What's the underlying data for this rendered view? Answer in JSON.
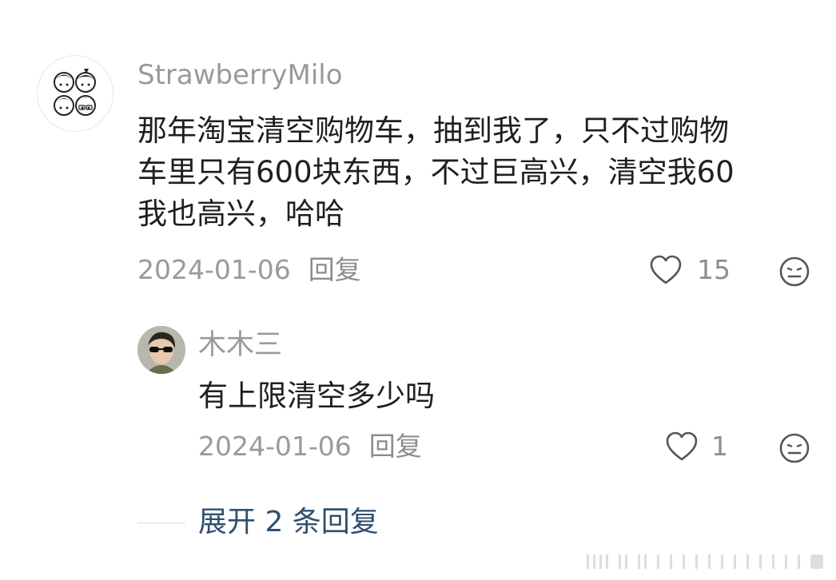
{
  "comment": {
    "username": "StrawberryMilo",
    "text": "那年淘宝清空购物车，抽到我了，只不过购物\n车里只有600块东西，不过巨高兴，清空我60\n我也高兴，哈哈",
    "date": "2024-01-06",
    "reply_label": "回复",
    "likes": "15",
    "like_icon": "heart-outline-icon",
    "emoji_icon": "neutral-face-icon",
    "avatar_icon": "cartoon-faces-avatar"
  },
  "reply": {
    "username": "木木三",
    "text": "有上限清空多少吗",
    "date": "2024-01-06",
    "reply_label": "回复",
    "likes": "1",
    "like_icon": "heart-outline-icon",
    "emoji_icon": "neutral-face-icon",
    "avatar_icon": "person-with-sunglasses-avatar"
  },
  "expand": {
    "label": "展开 2 条回复"
  },
  "colors": {
    "username": "#9a9a9a",
    "body": "#1f1f1f",
    "meta": "#9a9a9a",
    "expand": "#2f4f6f"
  }
}
